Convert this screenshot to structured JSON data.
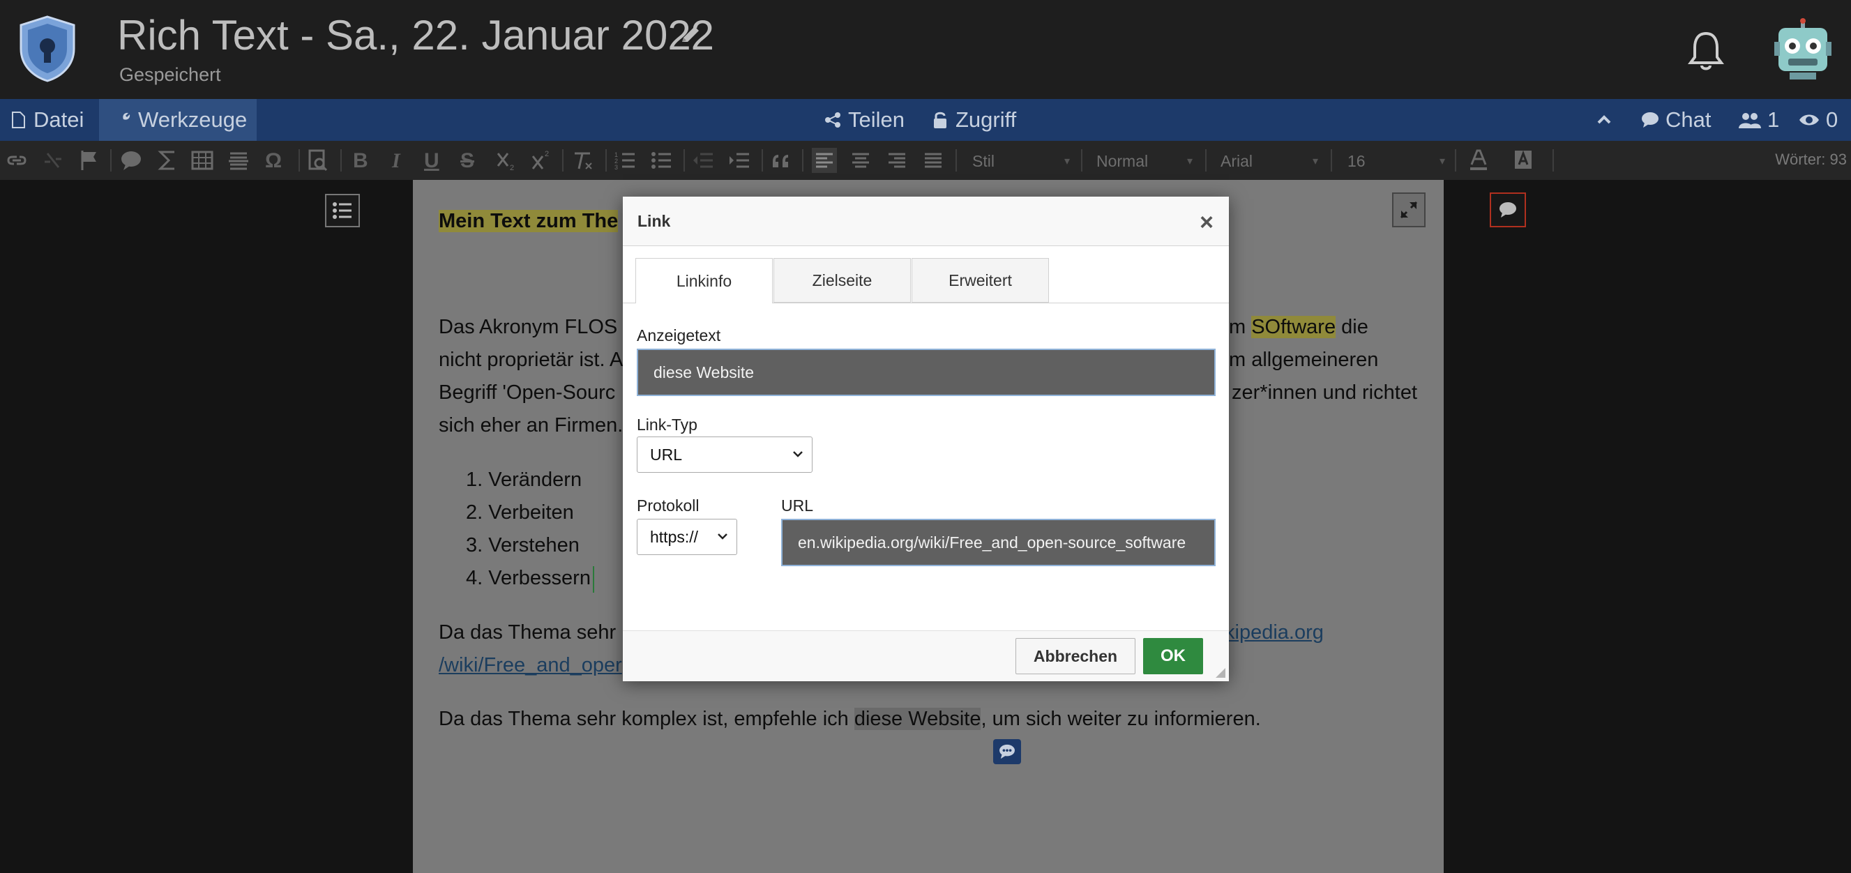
{
  "header": {
    "title": "Rich Text - Sa., 22. Januar 2022",
    "status": "Gespeichert"
  },
  "menu": {
    "file": "Datei",
    "tools": "Werkzeuge",
    "share": "Teilen",
    "access": "Zugriff",
    "chat": "Chat",
    "users_count": "1",
    "viewers_count": "0"
  },
  "toolbar": {
    "bold": "B",
    "italic": "I",
    "underline": "U",
    "strike": "S",
    "omega": "Ω",
    "style_select": "Stil",
    "format_select": "Normal",
    "font_select": "Arial",
    "size_select": "16",
    "word_count": "Wörter: 93"
  },
  "document": {
    "heading_visible": "Mein Text zum The",
    "p1_l1_a": "Das Akronym FLOS",
    "p1_l1_b": "m ",
    "p1_l1_hl": "SOftware",
    "p1_l1_c": " die",
    "p1_l2_a": "nicht proprietär ist. A",
    "p1_l2_b": "m allgemeineren",
    "p1_l3_a": "Begriff 'Open-Sourc",
    "p1_l3_b": "zer*innen und richtet",
    "p1_l4_a": "sich eher an Firmen.",
    "list": [
      "1. Verändern",
      "2. Verbeiten",
      "3. Verstehen",
      "4. Verbessern"
    ],
    "p2_l1_a": "Da das Thema sehr",
    "p2_l1_link": "kipedia.org",
    "p2_l2_link": "/wiki/Free_and_oper",
    "p3_a": "Da das Thema sehr komplex ist, empfehle ich ",
    "p3_hl": "diese Website",
    "p3_b": ", um sich weiter zu informieren."
  },
  "dialog": {
    "title": "Link",
    "close": "×",
    "tabs": [
      "Linkinfo",
      "Zielseite",
      "Erweitert"
    ],
    "display_text_label": "Anzeigetext",
    "display_text_value": "diese Website",
    "link_type_label": "Link-Typ",
    "link_type_value": "URL",
    "protocol_label": "Protokoll",
    "protocol_value": "https://",
    "url_label": "URL",
    "url_value": "en.wikipedia.org/wiki/Free_and_open-source_software",
    "cancel": "Abbrechen",
    "ok": "OK"
  },
  "colors": {
    "menubar": "#1d3a6a",
    "ok_button": "#2f8a3f",
    "highlight": "#908a3a"
  }
}
